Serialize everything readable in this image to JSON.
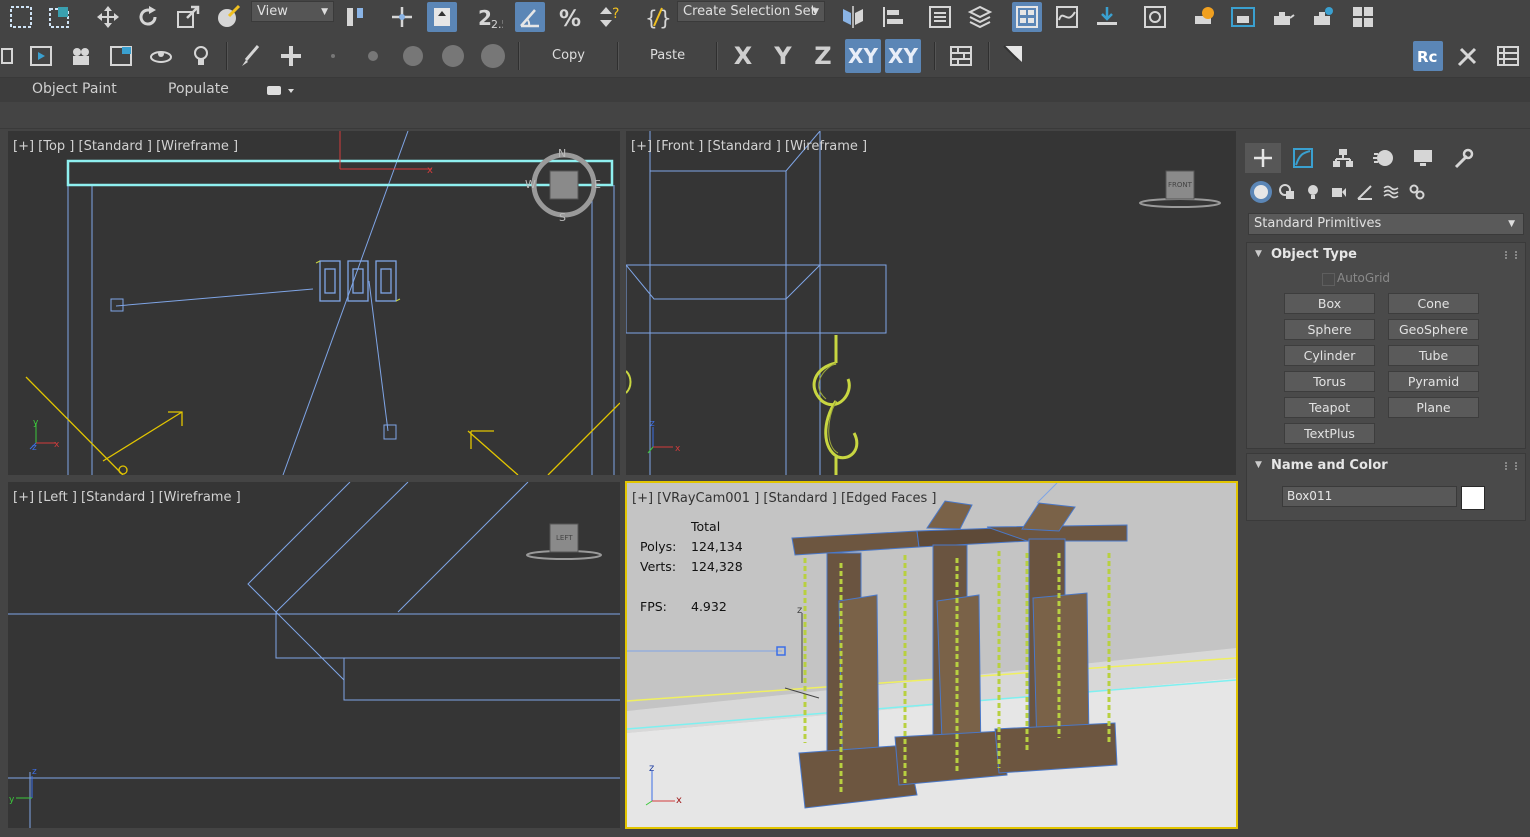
{
  "toolbar_top": {
    "view_dropdown": "View",
    "selection_set_dropdown": "Create Selection Set",
    "snap_angle_label": "2.5",
    "icons": [
      "select-region-rect-icon",
      "select-window-icon",
      "move-icon",
      "rotate-icon",
      "scale-icon",
      "select-manipulate-icon",
      "use-pivot-icon",
      "select-and-link-icon",
      "snaps-icon",
      "angle-snap-icon",
      "percent-snap-icon",
      "spinner-snap-icon",
      "named-selection-icon",
      "mirror-icon",
      "align-icon",
      "scene-explorer-icon",
      "layer-explorer-icon",
      "toggle-ribbon-icon",
      "curve-editor-icon",
      "schematic-view-icon",
      "material-editor-icon",
      "render-setup-icon",
      "rendered-frame-icon",
      "render-icon",
      "render-iterative-icon",
      "render-cloud-icon",
      "render-grid-icon"
    ]
  },
  "toolbar_second": {
    "copy_label": "Copy",
    "paste_label": "Paste",
    "axes": [
      "X",
      "Y",
      "Z",
      "XY",
      "XY"
    ],
    "active_axes": [
      "XY"
    ]
  },
  "ribbon": {
    "tabs": [
      "Object Paint",
      "Populate"
    ]
  },
  "viewports": {
    "top": "[+] [Top ] [Standard ] [Wireframe ]",
    "front": "[+] [Front ] [Standard ] [Wireframe ]",
    "left": "[+] [Left ] [Standard ] [Wireframe ]",
    "camera": "[+] [VRayCam001 ] [Standard ] [Edged Faces ]",
    "viewcube_front": "FRONT",
    "viewcube_left": "LEFT",
    "compass": {
      "n": "N",
      "s": "S",
      "e": "E",
      "w": "W"
    }
  },
  "stats": {
    "total_label": "Total",
    "polys_label": "Polys:",
    "polys_value": "124,134",
    "verts_label": "Verts:",
    "verts_value": "124,328",
    "fps_label": "FPS:",
    "fps_value": "4.932"
  },
  "command_panel": {
    "category_dropdown": "Standard Primitives",
    "object_type": {
      "title": "Object Type",
      "autogrid_label": "AutoGrid",
      "autogrid_checked": false,
      "buttons": [
        "Box",
        "Cone",
        "Sphere",
        "GeoSphere",
        "Cylinder",
        "Tube",
        "Torus",
        "Pyramid",
        "Teapot",
        "Plane",
        "TextPlus"
      ]
    },
    "name_and_color": {
      "title": "Name and Color",
      "name_value": "Box011",
      "color": "#ffffff"
    }
  },
  "colors": {
    "accent_blue": "#5b86b6",
    "wire_blue": "#7fa5e6",
    "selected_yellow": "#c8d641",
    "camera_yellow": "#e2c500"
  }
}
